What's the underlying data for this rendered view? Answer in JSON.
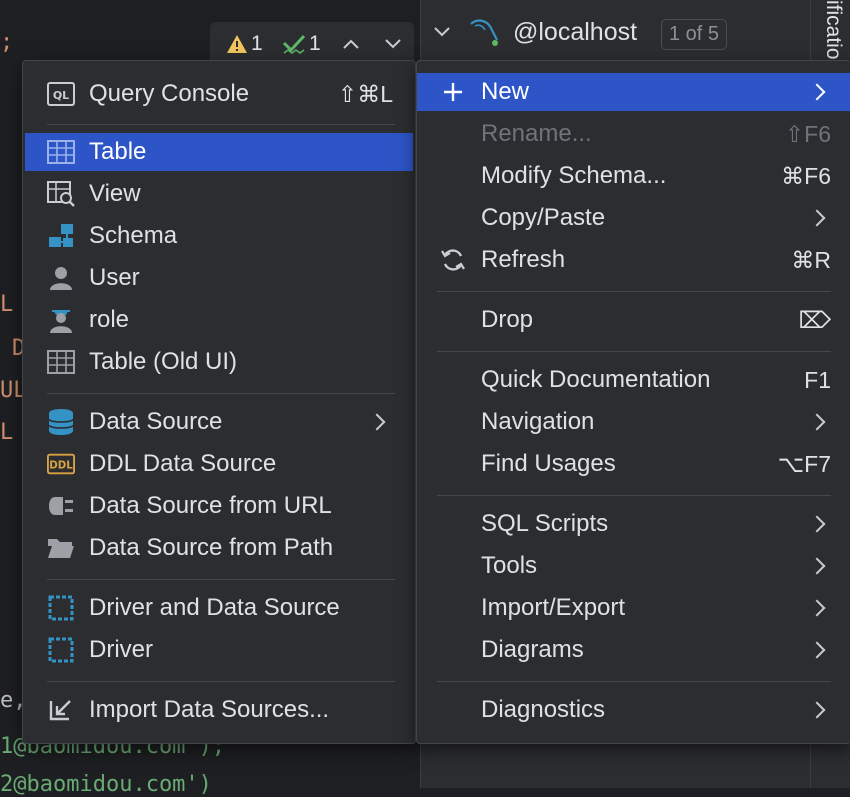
{
  "editor": {
    "code_fragments": [
      ";",
      "L",
      "D",
      "UL",
      "L",
      "e,",
      "1@baomidou.com');",
      "2@baomidou.com')"
    ],
    "warnings_count": "1",
    "checks_count": "1"
  },
  "db_panel": {
    "connection_name": "@localhost",
    "connection_badge": "1 of 5",
    "side_tab_label": "ification"
  },
  "left_menu": {
    "items": [
      {
        "label": "Query Console",
        "shortcut": "⇧⌘L",
        "icon": "query-console-icon"
      },
      {
        "label": "Table",
        "icon": "table-icon"
      },
      {
        "label": "View",
        "icon": "view-icon"
      },
      {
        "label": "Schema",
        "icon": "schema-icon"
      },
      {
        "label": "User",
        "icon": "user-icon"
      },
      {
        "label": "role",
        "icon": "role-icon"
      },
      {
        "label": "Table (Old UI)",
        "icon": "table-icon"
      },
      {
        "label": "Data Source",
        "icon": "database-icon"
      },
      {
        "label": "DDL Data Source",
        "icon": "ddl-icon"
      },
      {
        "label": "Data Source from URL",
        "icon": "plug-icon"
      },
      {
        "label": "Data Source from Path",
        "icon": "folder-icon"
      },
      {
        "label": "Driver and Data Source",
        "icon": "driver-icon"
      },
      {
        "label": "Driver",
        "icon": "driver-icon"
      },
      {
        "label": "Import Data Sources...",
        "icon": "import-icon"
      }
    ]
  },
  "right_menu": {
    "items": [
      {
        "label": "New",
        "icon": "plus-icon"
      },
      {
        "label": "Rename...",
        "shortcut": "⇧F6"
      },
      {
        "label": "Modify Schema...",
        "shortcut": "⌘F6"
      },
      {
        "label": "Copy/Paste"
      },
      {
        "label": "Refresh",
        "shortcut": "⌘R",
        "icon": "refresh-icon"
      },
      {
        "label": "Drop",
        "shortcut": "⌦"
      },
      {
        "label": "Quick Documentation",
        "shortcut": "F1"
      },
      {
        "label": "Navigation"
      },
      {
        "label": "Find Usages",
        "shortcut": "⌥F7"
      },
      {
        "label": "SQL Scripts"
      },
      {
        "label": "Tools"
      },
      {
        "label": "Import/Export"
      },
      {
        "label": "Diagrams"
      },
      {
        "label": "Diagnostics"
      }
    ]
  },
  "colors": {
    "selection": "#2e55c7",
    "menu_bg": "#2b2d30",
    "accent_blue": "#3592c4",
    "warning": "#f2c55c",
    "ok": "#5fb865"
  }
}
